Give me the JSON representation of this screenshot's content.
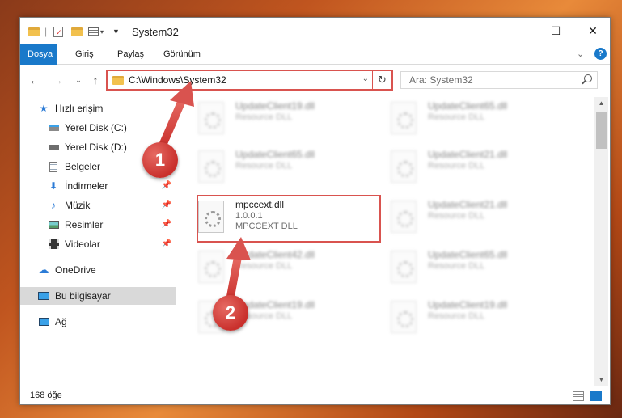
{
  "window": {
    "title": "System32",
    "controls": {
      "minimize": "—",
      "maximize": "☐",
      "close": "✕"
    }
  },
  "ribbon": {
    "tabs": [
      "Dosya",
      "Giriş",
      "Paylaş",
      "Görünüm"
    ],
    "active_tab": "Dosya",
    "expand_glyph": "⌄",
    "help_glyph": "?"
  },
  "address": {
    "path": "C:\\Windows\\System32",
    "search_placeholder": "Ara: System32"
  },
  "sidebar": {
    "items": [
      {
        "label": "Hızlı erişim",
        "icon": "star-icon",
        "pinned": false
      },
      {
        "label": "Yerel Disk (C:)",
        "icon": "drive-icon",
        "pinned": false
      },
      {
        "label": "Yerel Disk (D:)",
        "icon": "drive-icon",
        "pinned": false
      },
      {
        "label": "Belgeler",
        "icon": "document-icon",
        "pinned": true
      },
      {
        "label": "İndirmeler",
        "icon": "download-icon",
        "pinned": true
      },
      {
        "label": "Müzik",
        "icon": "music-icon",
        "pinned": true
      },
      {
        "label": "Resimler",
        "icon": "pictures-icon",
        "pinned": true
      },
      {
        "label": "Videolar",
        "icon": "video-icon",
        "pinned": true
      },
      {
        "label": "OneDrive",
        "icon": "cloud-icon",
        "pinned": false
      },
      {
        "label": "Bu bilgisayar",
        "icon": "computer-icon",
        "pinned": false,
        "selected": true
      },
      {
        "label": "Ağ",
        "icon": "network-icon",
        "pinned": false
      }
    ]
  },
  "files": {
    "highlighted": {
      "name": "mpccext.dll",
      "version": "1.0.0.1",
      "description": "MPCCEXT DLL"
    },
    "blurred": [
      {
        "name": "UpdateClient19.dll",
        "sub": "Resource DLL"
      },
      {
        "name": "UpdateClient65.dll",
        "sub": "Resource DLL"
      },
      {
        "name": "UpdateClient65.dll",
        "sub": "Resource DLL"
      },
      {
        "name": "UpdateClient21.dll",
        "sub": "Resource DLL"
      },
      {
        "name": "UpdateClient21.dll",
        "sub": "Resource DLL"
      },
      {
        "name": "UpdateClient42.dll",
        "sub": "Resource DLL"
      },
      {
        "name": "UpdateClient65.dll",
        "sub": "Resource DLL"
      },
      {
        "name": "UpdateClient19.dll",
        "sub": "Resource DLL"
      },
      {
        "name": "UpdateClient19.dll",
        "sub": "Resource DLL"
      }
    ]
  },
  "status": {
    "item_count": "168 öğe"
  },
  "annotations": {
    "step1": "1",
    "step2": "2"
  },
  "colors": {
    "accent": "#1979ca",
    "highlight": "#d9534f"
  }
}
